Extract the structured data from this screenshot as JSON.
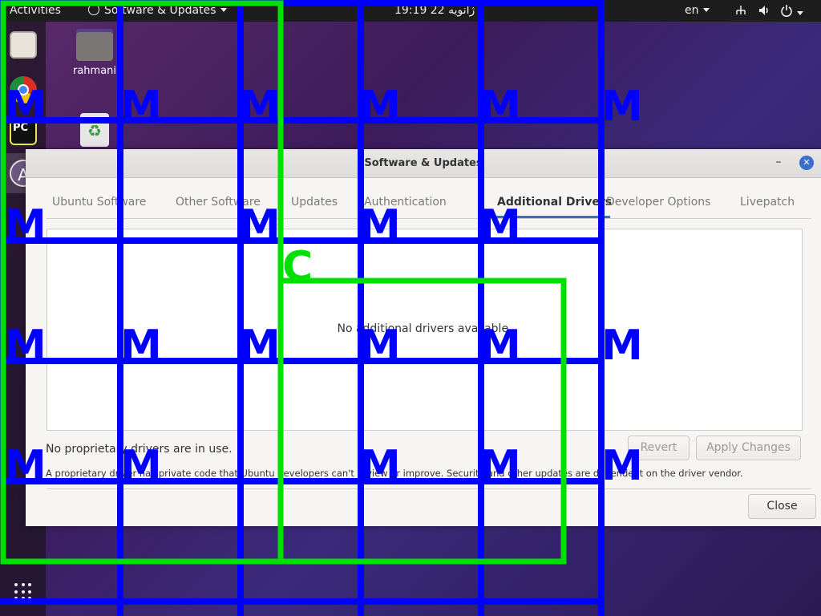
{
  "topbar": {
    "activities": "Activities",
    "app_name": "Software & Updates",
    "clock": "19:19  22 ژانویه",
    "language": "en"
  },
  "dock": {
    "icons": [
      "files-icon",
      "chrome-icon",
      "pycharm-icon",
      "software-store-icon",
      "show-apps-icon"
    ],
    "pycharm_text": "PC",
    "store_glyph": "A"
  },
  "desktop": {
    "home_label": "rahmani"
  },
  "window": {
    "title": "Software & Updates",
    "minimize_glyph": "–",
    "close_glyph": "✕",
    "tabs": [
      "Ubuntu Software",
      "Other Software",
      "Updates",
      "Authentication",
      "Additional Drivers",
      "Developer Options",
      "Livepatch"
    ],
    "active_tab": "Additional Drivers",
    "panel_message": "No additional drivers available.",
    "status": "No proprietary drivers are in use.",
    "info": "A proprietary driver has private code that Ubuntu developers can't review or improve. Security and other updates are dependent on the driver vendor.",
    "buttons": {
      "revert": "Revert",
      "apply": "Apply Changes",
      "close": "Close"
    }
  },
  "overlay": {
    "marker_label": "M",
    "corner_label": "C",
    "colors": {
      "blue": "#0000ff",
      "green": "#00e000"
    }
  }
}
